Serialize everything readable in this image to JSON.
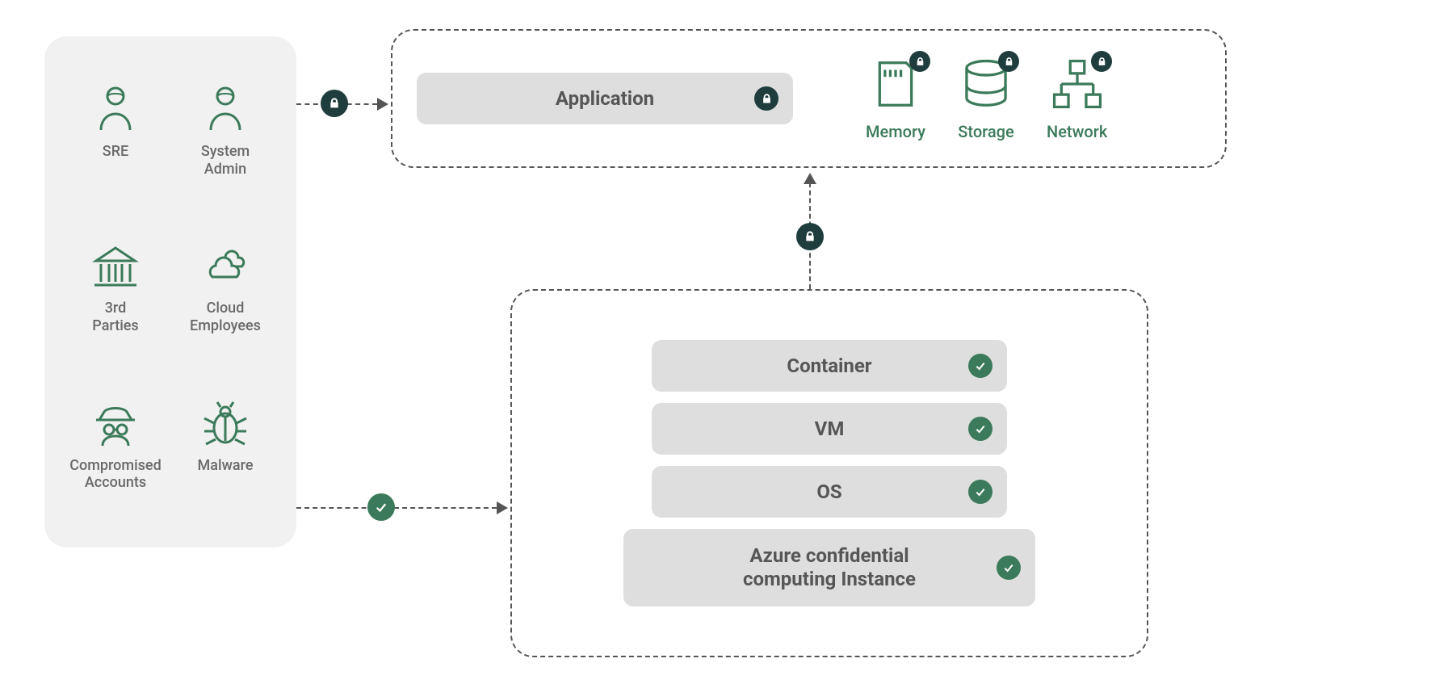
{
  "actors": [
    {
      "label": "SRE",
      "icon": "person"
    },
    {
      "label": "System\nAdmin",
      "icon": "person"
    },
    {
      "label": "3rd\nParties",
      "icon": "bank"
    },
    {
      "label": "Cloud\nEmployees",
      "icon": "clouds"
    },
    {
      "label": "Compromised\nAccounts",
      "icon": "spy"
    },
    {
      "label": "Malware",
      "icon": "bug"
    }
  ],
  "application": {
    "label": "Application",
    "resources": [
      {
        "label": "Memory",
        "icon": "memory"
      },
      {
        "label": "Storage",
        "icon": "storage"
      },
      {
        "label": "Network",
        "icon": "network"
      }
    ]
  },
  "stack": [
    {
      "label": "Container",
      "wide": false
    },
    {
      "label": "VM",
      "wide": false
    },
    {
      "label": "OS",
      "wide": false
    },
    {
      "label": "Azure confidential\ncomputing Instance",
      "wide": true
    }
  ]
}
